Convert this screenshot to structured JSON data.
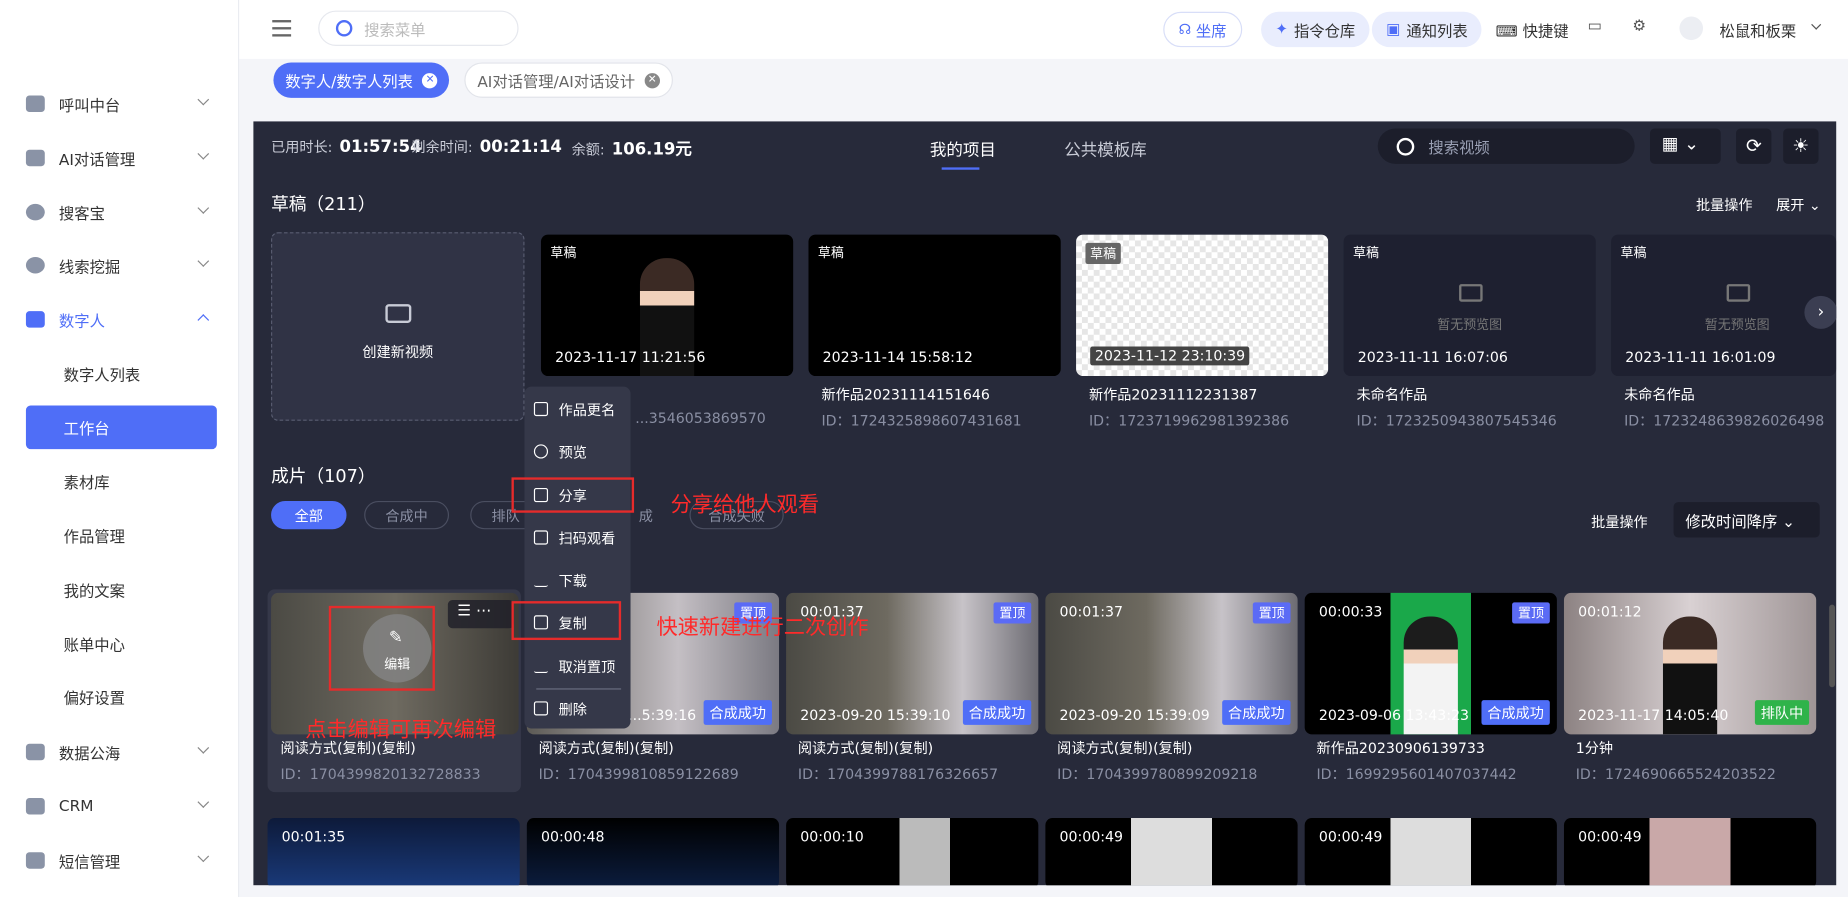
{
  "sidebar": {
    "items": [
      {
        "label": "呼叫中台"
      },
      {
        "label": "AI对话管理"
      },
      {
        "label": "搜客宝"
      },
      {
        "label": "线索挖掘"
      },
      {
        "label": "数字人"
      },
      {
        "label": "数据公海"
      },
      {
        "label": "CRM"
      },
      {
        "label": "短信管理"
      }
    ],
    "subitems": [
      {
        "label": "数字人列表"
      },
      {
        "label": "工作台"
      },
      {
        "label": "素材库"
      },
      {
        "label": "作品管理"
      },
      {
        "label": "我的文案"
      },
      {
        "label": "账单中心"
      },
      {
        "label": "偏好设置"
      }
    ]
  },
  "topbar": {
    "search_placeholder": "搜索菜单",
    "seat": "坐席",
    "cmd": "指令仓库",
    "notify": "通知列表",
    "hotkey": "快捷键",
    "user": "松鼠和板栗"
  },
  "tabs": [
    {
      "label": "数字人/数字人列表"
    },
    {
      "label": "AI对话管理/AI对话设计"
    }
  ],
  "main": {
    "used_label": "已用时长:",
    "used": "01:57:54",
    "remain_label": "剩余时间:",
    "remain": "00:21:14",
    "balance_label": "余额:",
    "balance": "106.19元",
    "tab_mine": "我的项目",
    "tab_public": "公共模板库",
    "search_placeholder": "搜索视频",
    "drafts_title": "草稿（211）",
    "batch": "批量操作",
    "expand": "展开",
    "create": "创建新视频",
    "drafts": [
      {
        "badge": "草稿",
        "ts": "2023-11-17 11:21:56",
        "title": "",
        "id": "...3546053869570"
      },
      {
        "badge": "草稿",
        "ts": "2023-11-14 15:58:12",
        "title": "新作品20231114151646",
        "id": "ID：1724325898607431681"
      },
      {
        "badge": "草稿",
        "ts": "2023-11-12 23:10:39",
        "title": "新作品20231112231387",
        "id": "ID：1723719962981392386"
      },
      {
        "badge": "草稿",
        "ts": "2023-11-11 16:07:06",
        "title": "未命名作品",
        "id": "ID：1723250943807545346",
        "nopreview": "暂无预览图"
      },
      {
        "badge": "草稿",
        "ts": "2023-11-11 16:01:09",
        "title": "未命名作品",
        "id": "ID：1723248639826026498",
        "nopreview": "暂无预览图"
      }
    ],
    "finished_title": "成片（107）",
    "chips": [
      {
        "label": "全部"
      },
      {
        "label": "合成中"
      },
      {
        "label": "排队"
      },
      {
        "label": "成"
      },
      {
        "label": "合成失败"
      }
    ],
    "sort": "修改时间降序",
    "films": [
      {
        "dur": "",
        "ts": "",
        "title": "阅读方式(复制)(复制)",
        "id": "ID：1704399820132728833",
        "status": ""
      },
      {
        "dur": "",
        "ts": "...5:39:16",
        "title": "阅读方式(复制)(复制)",
        "id": "ID：1704399810859122689",
        "status": "合成成功",
        "flag": "置顶"
      },
      {
        "dur": "00:01:37",
        "ts": "2023-09-20 15:39:10",
        "title": "阅读方式(复制)(复制)",
        "id": "ID：1704399788176326657",
        "status": "合成成功",
        "flag": "置顶"
      },
      {
        "dur": "00:01:37",
        "ts": "2023-09-20 15:39:09",
        "title": "阅读方式(复制)(复制)",
        "id": "ID：1704399780899209218",
        "status": "合成成功",
        "flag": "置顶"
      },
      {
        "dur": "00:00:33",
        "ts": "2023-09-06 13:43:23",
        "title": "新作品20230906139733",
        "id": "ID：1699295601407037442",
        "status": "合成成功",
        "flag": "置顶"
      },
      {
        "dur": "00:01:12",
        "ts": "2023-11-17 14:05:40",
        "title": "1分钟",
        "id": "ID：1724690665524203522",
        "status": "排队中"
      }
    ],
    "row3": [
      {
        "dur": "00:01:35"
      },
      {
        "dur": "00:00:48"
      },
      {
        "dur": "00:00:10"
      },
      {
        "dur": "00:00:49"
      },
      {
        "dur": "00:00:49"
      },
      {
        "dur": "00:00:49"
      }
    ],
    "edit": "编辑"
  },
  "menu": [
    {
      "label": "作品更名"
    },
    {
      "label": "预览"
    },
    {
      "label": "分享"
    },
    {
      "label": "扫码观看"
    },
    {
      "label": "下载"
    },
    {
      "label": "复制"
    },
    {
      "label": "取消置顶"
    },
    {
      "label": "删除"
    }
  ],
  "notes": {
    "share": "分享给他人观看",
    "copy": "快速新建进行二次创作",
    "edit": "点击编辑可再次编辑"
  },
  "colors": {
    "accent": "#4f6ef7",
    "dark": "#272a3a",
    "annot": "#ff2a2a"
  }
}
